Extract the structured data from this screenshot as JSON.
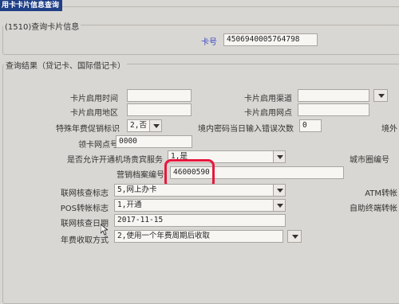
{
  "window": {
    "tab_title": "用卡卡片信息查询"
  },
  "query_group": {
    "title": "(1510)查询卡片信息",
    "card_no_label": "卡号",
    "card_no_value": "4506940005764798"
  },
  "result_group": {
    "title": "查询结果（贷记卡、国际借记卡）"
  },
  "fields": {
    "card_enable_time_label": "卡片启用时间",
    "card_enable_time_value": "",
    "card_enable_channel_label": "卡片启用渠道",
    "card_enable_channel_value": "",
    "card_enable_region_label": "卡片启用地区",
    "card_enable_region_value": "",
    "card_enable_outlet_label": "卡片启用网点",
    "card_enable_outlet_value": "",
    "special_fee_label": "特殊年费促销标识",
    "special_fee_value": "2,否",
    "pwd_error_label": "境内密码当日输入错误次数",
    "pwd_error_value": "0",
    "overseas_label_partial": "境外",
    "pickup_outlet_label": "领卡网点号",
    "pickup_outlet_value": "0000",
    "airport_vip_label": "是否允许开通机场贵宾服务",
    "airport_vip_value": "1,是",
    "city_circle_label": "城市圈编号",
    "marketing_no_label": "营销档案编号",
    "marketing_no_value": "46000590",
    "network_check_flag_label": "联网核查标志",
    "network_check_flag_value": "5,网上办卡",
    "atm_transfer_label": "ATM转帐",
    "pos_transfer_label": "POS转帐标志",
    "pos_transfer_value": "1,开通",
    "self_service_label": "自助终端转帐",
    "network_check_date_label": "联网核查日期",
    "network_check_date_value": "2017-11-15",
    "annual_fee_method_label": "年费收取方式",
    "annual_fee_method_value": "2,使用一个年费周期后收取"
  },
  "colors": {
    "title_bar": "#1f3f86",
    "highlight": "#e8173d",
    "card_label": "#3a46c4"
  }
}
